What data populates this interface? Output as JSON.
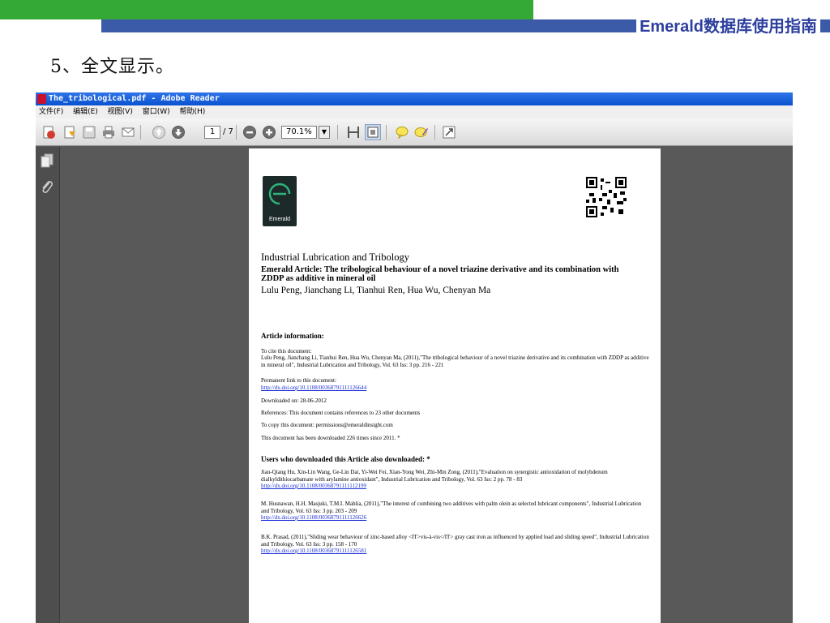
{
  "slide": {
    "brand": "Emerald数据库使用指南",
    "step": "5、全文显示。",
    "colors": {
      "green_bar": "#35a935",
      "blue_bar": "#3b5ba8",
      "brand_text": "#2c3f9e"
    }
  },
  "window": {
    "title": "The_tribological.pdf - Adobe Reader",
    "menu": [
      "文件(F)",
      "编辑(E)",
      "视图(V)",
      "窗口(W)",
      "帮助(H)"
    ],
    "toolbar": {
      "icons": [
        "create-pdf-icon",
        "open-icon",
        "save-icon",
        "print-icon",
        "email-icon",
        "prev-page-icon",
        "next-page-icon",
        "zoom-out-icon",
        "zoom-in-icon",
        "fit-width-icon",
        "fit-page-icon",
        "comment-icon",
        "sign-icon",
        "fullscreen-icon"
      ],
      "page_current": "1",
      "page_total": "/ 7",
      "zoom": "70.1%"
    },
    "side_icons": [
      "pages-icon",
      "attachments-icon"
    ]
  },
  "pdf": {
    "logo_text": "Emerald",
    "journal": "Industrial Lubrication and Tribology",
    "article_title": "Emerald Article: The tribological behaviour of a novel triazine derivative and its combination with ZDDP as additive in mineral oil",
    "authors": "Lulu Peng, Jianchang Li, Tianhui Ren, Hua Wu, Chenyan Ma",
    "info_heading": "Article information:",
    "cite_label": "To cite this document:",
    "cite_text": "Lulu Peng, Jianchang Li, Tianhui Ren, Hua Wu, Chenyan Ma, (2011),\"The tribological behaviour of a novel triazine derivative and its combination with ZDDP as additive in mineral oil\", Industrial Lubrication and Tribology, Vol. 63 Iss: 3 pp. 216 - 221",
    "permalink_label": "Permanent link to this document:",
    "permalink": "http://dx.doi.org/10.1108/00368791111126644",
    "downloaded_on": "Downloaded on: 28-06-2012",
    "references": "References: This document contains references to 23 other documents",
    "copy": "To copy this document: permissions@emeraldinsight.com",
    "download_count": "This document has been downloaded 226 times since 2011. *",
    "also_heading": "Users who downloaded this Article also downloaded: *",
    "also": [
      {
        "text": "Jian-Qiang Hu, Xin-Lin Wang, Ge-Lin Dai, Yi-Wei Fei, Xian-Yong Wei, Zhi-Min Zong, (2011),\"Evaluation on synergistic antioxidation of molybdenum dialkyldithiocarbamate with arylamine antioxidant\", Industrial Lubrication and Tribology, Vol. 63 Iss: 2 pp. 78 - 83",
        "link": "http://dx.doi.org/10.1108/00368791111112199"
      },
      {
        "text": "M. Husnawan, H.H. Masjuki, T.M.I. Mahlia, (2011),\"The interest of combining two additives with palm olein as selected lubricant components\", Industrial Lubrication and Tribology, Vol. 63 Iss: 3 pp. 203 - 209",
        "link": "http://dx.doi.org/10.1108/00368791111126626"
      },
      {
        "text": "B.K. Prasad, (2011),\"Sliding wear behaviour of zinc-based alloy <IT>vis-à-vis</IT> gray cast iron as influenced by applied load and sliding speed\", Industrial Lubrication and Tribology, Vol. 63 Iss: 3 pp. 158 - 170",
        "link": "http://dx.doi.org/10.1108/00368791111126581"
      }
    ]
  }
}
